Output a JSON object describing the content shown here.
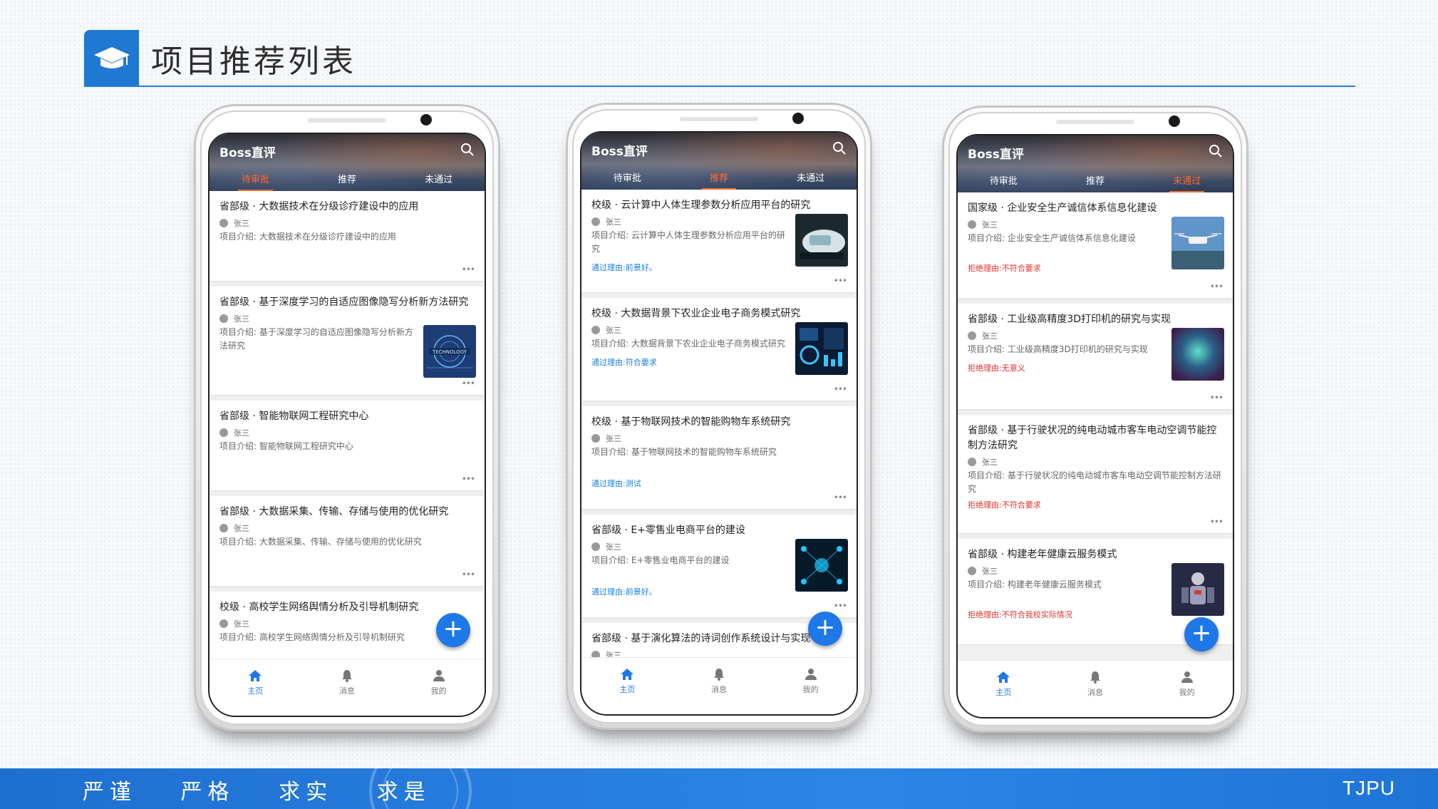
{
  "header": {
    "title": "项目推荐列表"
  },
  "footer": {
    "motto": [
      "严谨",
      "严格",
      "求实",
      "求是"
    ],
    "brand": "TJPU"
  },
  "colors": {
    "accent": "#1f78d1",
    "active_tab": "#ff6a2b",
    "pass": "#1e7fd8",
    "reject": "#e0322c"
  },
  "phones": [
    {
      "app_title": "Boss直评",
      "tabs": [
        "待审批",
        "推荐",
        "未通过"
      ],
      "active_tab": 0,
      "nav": [
        "主页",
        "消息",
        "我的"
      ],
      "cards": [
        {
          "title": "省部级 · 大数据技术在分级诊疗建设中的应用",
          "author": "张三",
          "intro": "项目介绍: 大数据技术在分级诊疗建设中的应用"
        },
        {
          "title": "省部级 · 基于深度学习的自适应图像隐写分析新方法研究",
          "author": "张三",
          "intro": "项目介绍: 基于深度学习的自适应图像隐写分析新方法研究",
          "thumb": "technology"
        },
        {
          "title": "省部级 · 智能物联网工程研究中心",
          "author": "张三",
          "intro": "项目介绍: 智能物联网工程研究中心"
        },
        {
          "title": "省部级 · 大数据采集、传输、存储与使用的优化研究",
          "author": "张三",
          "intro": "项目介绍: 大数据采集、传输、存储与使用的优化研究"
        },
        {
          "title": "校级 · 高校学生网络舆情分析及引导机制研究",
          "author": "张三",
          "intro": "项目介绍: 高校学生网络舆情分析及引导机制研究"
        }
      ]
    },
    {
      "app_title": "Boss直评",
      "tabs": [
        "待审批",
        "推荐",
        "未通过"
      ],
      "active_tab": 1,
      "nav": [
        "主页",
        "消息",
        "我的"
      ],
      "cards": [
        {
          "title": "校级 · 云计算中人体生理参数分析应用平台的研究",
          "author": "张三",
          "intro": "项目介绍: 云计算中人体生理参数分析应用平台的研究",
          "reason": "通过理由:前景好。",
          "thumb": "car"
        },
        {
          "title": "校级 · 大数据背景下农业企业电子商务模式研究",
          "author": "张三",
          "intro": "项目介绍: 大数据背景下农业企业电子商务模式研究",
          "reason": "通过理由:符合要求",
          "thumb": "dashboard"
        },
        {
          "title": "校级 · 基于物联网技术的智能购物车系统研究",
          "author": "张三",
          "intro": "项目介绍: 基于物联网技术的智能购物车系统研究",
          "reason": "通过理由:测试"
        },
        {
          "title": "省部级 · E+零售业电商平台的建设",
          "author": "张三",
          "intro": "项目介绍: E+零售业电商平台的建设",
          "reason": "通过理由:前景好。",
          "thumb": "network"
        },
        {
          "title": "省部级 · 基于演化算法的诗词创作系统设计与实现",
          "author": "张三",
          "intro": ""
        }
      ]
    },
    {
      "app_title": "Boss直评",
      "tabs": [
        "待审批",
        "推荐",
        "未通过"
      ],
      "active_tab": 2,
      "nav": [
        "主页",
        "消息",
        "我的"
      ],
      "cards": [
        {
          "title": "国家级 · 企业安全生产诚信体系信息化建设",
          "author": "张三",
          "intro": "项目介绍: 企业安全生产诚信体系信息化建设",
          "reason": "拒绝理由:不符合要求",
          "thumb": "drone"
        },
        {
          "title": "省部级 · 工业级高精度3D打印机的研究与实现",
          "author": "张三",
          "intro": "项目介绍: 工业级高精度3D打印机的研究与实现",
          "reason": "拒绝理由:无意义",
          "thumb": "nebula"
        },
        {
          "title": "省部级 · 基于行驶状况的纯电动城市客车电动空调节能控制方法研究",
          "author": "张三",
          "intro": "项目介绍: 基于行驶状况的纯电动城市客车电动空调节能控制方法研究",
          "reason": "拒绝理由:不符合要求"
        },
        {
          "title": "省部级 · 构建老年健康云服务模式",
          "author": "张三",
          "intro": "项目介绍: 构建老年健康云服务模式",
          "reason": "拒绝理由:不符合我校实际情况",
          "thumb": "robot"
        }
      ]
    }
  ]
}
